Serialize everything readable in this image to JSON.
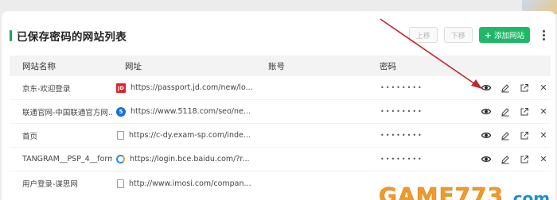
{
  "header": {
    "title": "已保存密码的网站列表"
  },
  "toolbar": {
    "move_up_label": "上移",
    "move_down_label": "下移",
    "add_label": "添加网站",
    "add_plus": "+"
  },
  "table": {
    "columns": {
      "name": "网站名称",
      "url": "网址",
      "account": "账号",
      "password": "密码"
    },
    "rows": [
      {
        "name": "京东-欢迎登录",
        "favicon": "jd-favicon",
        "url": "https://passport.jd.com/new/lo...",
        "account": "",
        "password": "••••••••"
      },
      {
        "name": "联通官网-中国联通官方网...",
        "favicon": "5118-favicon",
        "url": "https://www.5118.com/seo/ne...",
        "account": "",
        "password": "••••••••"
      },
      {
        "name": "首页",
        "favicon": "document-favicon",
        "url": "https://c-dy.exam-sp.com/inde...",
        "account": "",
        "password": "••••••••"
      },
      {
        "name": "TANGRAM__PSP_4__form",
        "favicon": "baidu-cloud-favicon",
        "url": "https://login.bce.baidu.com/?r...",
        "account": "",
        "password": "••••••••"
      },
      {
        "name": "用户登录-谋思网",
        "favicon": "document-favicon",
        "url": "http://www.imosi.com/compan...",
        "account": "",
        "password": ""
      }
    ]
  },
  "favicon_glyphs": {
    "jd": "JD",
    "fiveone": "5"
  },
  "icons": {
    "view": "eye-icon",
    "edit": "pencil-icon",
    "open": "external-link-icon",
    "delete": "close-icon"
  },
  "glyphs": {
    "delete": "✕"
  },
  "watermark": {
    "text": "GAME773",
    "suffix": ".com"
  },
  "colors": {
    "accent": "#1aa55a",
    "add_button": "#20b868",
    "arrow": "#c0272d",
    "watermark": "#f09a2a",
    "watermark_suffix": "#1a8fd1"
  }
}
